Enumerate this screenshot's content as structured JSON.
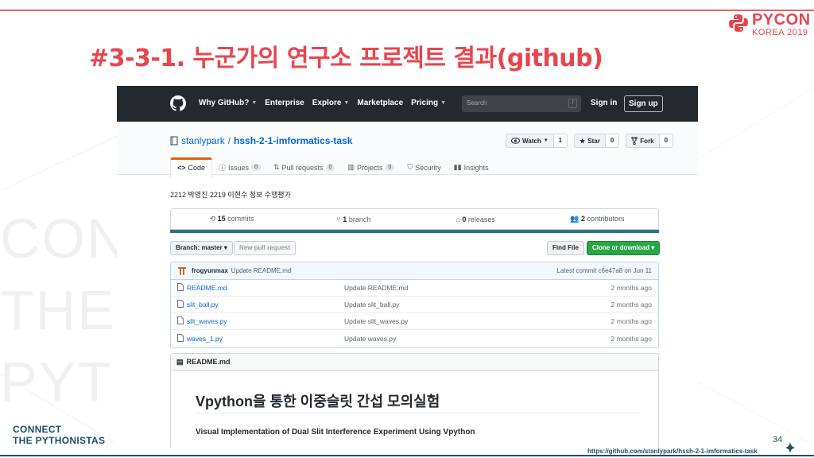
{
  "slide": {
    "title": "#3-3-1. 누군가의 연구소 프로젝트 결과(github)",
    "brand": "PYCON",
    "brand_sub": "KOREA 2019",
    "footer_line1": "CONNECT",
    "footer_line2": "THE PYTHONISTAS",
    "page_number": "34",
    "source_url": "https://github.com/stanlypark/hssh-2-1-imformatics-task",
    "accent_color": "#e8454d",
    "footer_color": "#1d4e63"
  },
  "github": {
    "header": {
      "nav": [
        {
          "label": "Why GitHub?",
          "caret": true
        },
        {
          "label": "Enterprise",
          "caret": false
        },
        {
          "label": "Explore",
          "caret": true
        },
        {
          "label": "Marketplace",
          "caret": false
        },
        {
          "label": "Pricing",
          "caret": true
        }
      ],
      "search_placeholder": "Search",
      "search_shortcut": "/",
      "sign_in": "Sign in",
      "sign_up": "Sign up"
    },
    "repo": {
      "owner": "stanlypark",
      "separator": "/",
      "name": "hssh-2-1-imformatics-task",
      "watch_label": "Watch",
      "watch_count": "1",
      "star_label": "Star",
      "star_count": "0",
      "fork_label": "Fork",
      "fork_count": "0"
    },
    "tabs": [
      {
        "label": "Code",
        "count": null,
        "icon": "code-icon"
      },
      {
        "label": "Issues",
        "count": "0",
        "icon": "issue-icon"
      },
      {
        "label": "Pull requests",
        "count": "0",
        "icon": "pull-request-icon"
      },
      {
        "label": "Projects",
        "count": "0",
        "icon": "project-icon"
      },
      {
        "label": "Security",
        "count": null,
        "icon": "shield-icon"
      },
      {
        "label": "Insights",
        "count": null,
        "icon": "graph-icon"
      }
    ],
    "description": "2212 박영진 2219 이현수 정보 수행평가",
    "summary": {
      "commits_num": "15",
      "commits_label": "commits",
      "branch_num": "1",
      "branch_label": "branch",
      "releases_num": "0",
      "releases_label": "releases",
      "contributors_num": "2",
      "contributors_label": "contributors"
    },
    "branch_select": "Branch: master ▾",
    "new_pull_request": "New pull request",
    "find_file": "Find File",
    "clone_download": "Clone or download ▾",
    "latest_commit": {
      "user": "frogyunmax",
      "message": "Update README.md",
      "info": "Latest commit c6e47a8 on Jun 11"
    },
    "files": [
      {
        "name": "README.md",
        "message": "Update README.md",
        "age": "2 months ago"
      },
      {
        "name": "slit_ball.py",
        "message": "Update slit_ball.py",
        "age": "2 months ago"
      },
      {
        "name": "slit_waves.py",
        "message": "Update slit_waves.py",
        "age": "2 months ago"
      },
      {
        "name": "waves_1.py",
        "message": "Update waves.py",
        "age": "2 months ago"
      }
    ],
    "readme": {
      "header": "README.md",
      "heading": "Vpython을 통한 이중슬릿 간섭 모의실험",
      "subheading": "Visual Implementation of Dual Slit Interference Experiment Using Vpython"
    }
  }
}
